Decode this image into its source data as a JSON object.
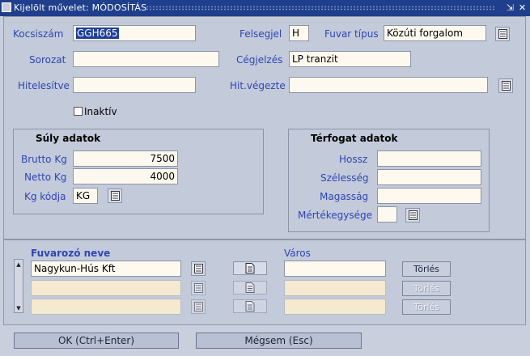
{
  "window": {
    "title": "Kijelölt művelet: MÓDOSÍTÁS",
    "minimize_glyph": "⇲",
    "close_glyph": "✕"
  },
  "fields": {
    "kocsiszam": {
      "label": "Kocsiszám",
      "value": "GGH665"
    },
    "felsegjel": {
      "label": "Felsegjel",
      "value": "H"
    },
    "fuvar_tipus": {
      "label": "Fuvar típus",
      "value": "Közúti forgalom"
    },
    "sorozat": {
      "label": "Sorozat",
      "value": ""
    },
    "cegjelzes": {
      "label": "Cégjelzés",
      "value": "LP tranzit"
    },
    "hitelesitve": {
      "label": "Hitelesítve",
      "value": ""
    },
    "hit_vegezte": {
      "label": "Hit.végezte",
      "value": ""
    },
    "inaktiv": {
      "label": "Inaktív",
      "checked": false
    }
  },
  "suly": {
    "title": "Súly adatok",
    "brutto": {
      "label": "Brutto Kg",
      "value": "7500"
    },
    "netto": {
      "label": "Netto Kg",
      "value": "4000"
    },
    "kg_kod": {
      "label": "Kg kódja",
      "value": "KG"
    }
  },
  "terfogat": {
    "title": "Térfogat adatok",
    "hossz": {
      "label": "Hossz",
      "value": ""
    },
    "szelesseg": {
      "label": "Szélesség",
      "value": ""
    },
    "magassag": {
      "label": "Magasság",
      "value": ""
    },
    "mertekegyseg": {
      "label": "Mértékegysége",
      "value": ""
    }
  },
  "detail": {
    "col_fuvarozo": "Fuvarozó neve",
    "col_varos": "Város",
    "delete_label": "Törlés",
    "rows": [
      {
        "fuvarozo": "Nagykun-Hús Kft",
        "varos": ""
      },
      {
        "fuvarozo": "",
        "varos": ""
      },
      {
        "fuvarozo": "",
        "varos": ""
      }
    ]
  },
  "buttons": {
    "ok": "OK (Ctrl+Enter)",
    "cancel": "Mégsem (Esc)"
  },
  "colors": {
    "titlebar": "#1f3f8c",
    "label": "#2f45b5",
    "field_bg": "#fdf9ee",
    "disabled_field_bg": "#f5e9cf",
    "panel": "#c3cad9"
  }
}
